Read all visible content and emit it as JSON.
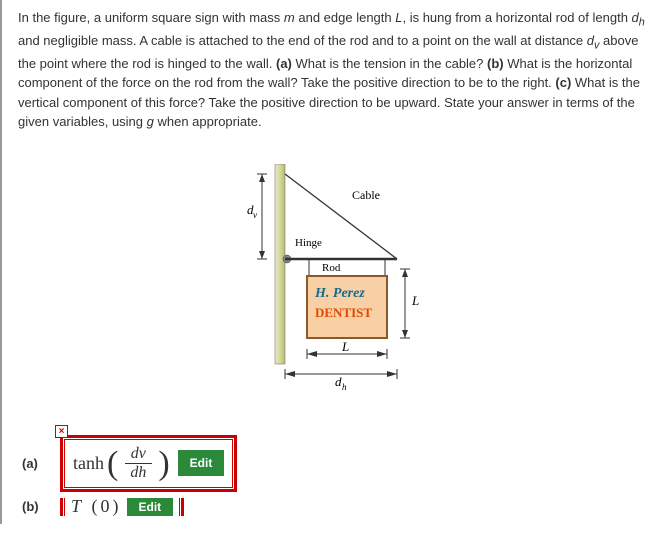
{
  "question": {
    "text_html": "In the figure, a uniform square sign with mass <i>m</i> and edge length <i>L</i>, is hung from a horizontal rod of length <i>d<sub>h</sub></i> and negligible mass. A cable is attached to the end of the rod and to a point on the wall at distance <i>d<sub>v</sub></i> above the point where the rod is hinged to the wall. <b>(a)</b> What is the tension in the cable? <b>(b)</b> What is the horizontal component of the force on the rod from the wall? Take the positive direction to be to the right. <b>(c)</b> What is the vertical component of this force? Take the positive direction to be upward. State your answer in terms of the given variables, using <i>g</i> when appropriate."
  },
  "figure": {
    "labels": {
      "cable": "Cable",
      "dv": "d",
      "dv_sub": "v",
      "hinge": "Hinge",
      "rod": "Rod",
      "sign_line1": "H. Perez",
      "sign_line2": "DENTIST",
      "L_side": "L",
      "L_bottom": "L",
      "dh": "d",
      "dh_sub": "h"
    }
  },
  "answers": {
    "a": {
      "part": "(a)",
      "func": "tanh",
      "num": "dv",
      "den": "dh",
      "edit": "Edit",
      "close": "×"
    },
    "b": {
      "part": "(b)",
      "display": "T (0)",
      "edit": "Edit",
      "close": "×"
    }
  }
}
